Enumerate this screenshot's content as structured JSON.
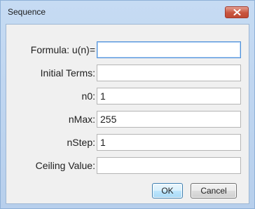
{
  "window": {
    "title": "Sequence",
    "close_icon": "close-x-icon"
  },
  "fields": [
    {
      "label": "Formula: u(n)=",
      "value": "",
      "focused": true
    },
    {
      "label": "Initial Terms:",
      "value": ""
    },
    {
      "label": "n0:",
      "value": "1"
    },
    {
      "label": "nMax:",
      "value": "255"
    },
    {
      "label": "nStep:",
      "value": "1"
    },
    {
      "label": "Ceiling Value:",
      "value": ""
    }
  ],
  "buttons": {
    "ok_label": "OK",
    "cancel_label": "Cancel"
  },
  "colors": {
    "title_bar": "#c6dbf3",
    "close_button": "#c8553f",
    "focus_border": "#4f90d9",
    "default_button_border": "#3c7fb1"
  }
}
